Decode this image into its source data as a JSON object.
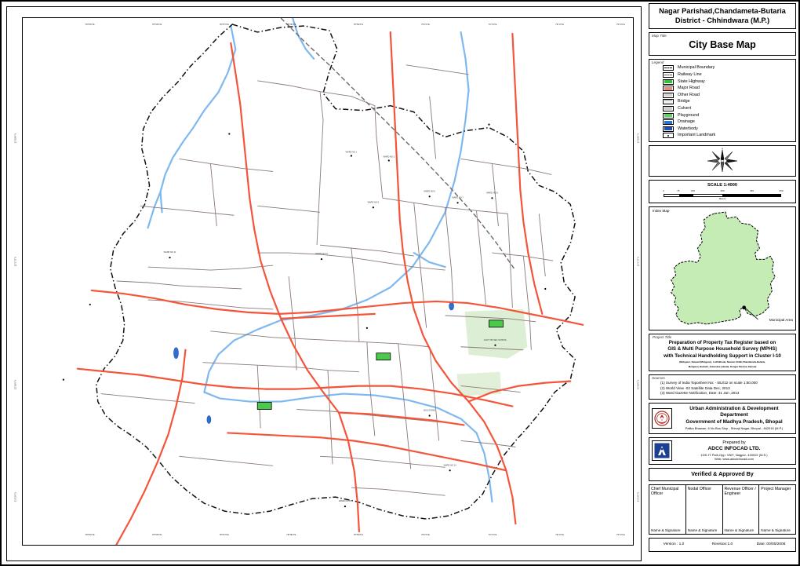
{
  "title_block": {
    "line1": "Nagar  Parishad,Chandameta-Butaria",
    "line2": "District - Chhindwara (M.P.)"
  },
  "map_title": {
    "label": "Map Title",
    "value": "City Base Map"
  },
  "legend": {
    "label": "Legend",
    "items": [
      {
        "name": "Municipal Boundary",
        "symbol": "dashed-boundary",
        "color": "#000000"
      },
      {
        "name": "Railway Line",
        "symbol": "railway-dash",
        "color": "#4a4a4a"
      },
      {
        "name": "State Highway",
        "symbol": "fill-block",
        "color": "#35c135"
      },
      {
        "name": "Major Road",
        "symbol": "fill-block",
        "color": "#f08878"
      },
      {
        "name": "Other Road",
        "symbol": "fill-block",
        "color": "#d9d4d4"
      },
      {
        "name": "Bridge",
        "symbol": "fill-block",
        "color": "#efefef"
      },
      {
        "name": "Culvert",
        "symbol": "fill-block",
        "color": "#cfcfcf"
      },
      {
        "name": "Playground",
        "symbol": "fill-block",
        "color": "#59d659"
      },
      {
        "name": "Drainage",
        "symbol": "fill-block",
        "color": "#2a72d4"
      },
      {
        "name": "Waterbody",
        "symbol": "fill-block",
        "color": "#1d4fb8"
      },
      {
        "name": "Important Landmark",
        "symbol": "point-dot",
        "color": "#000000"
      }
    ]
  },
  "north_arrow": {
    "label": "N"
  },
  "scale": {
    "title": "SCALE 1:4000",
    "ticks": [
      "0",
      "75",
      "150",
      "300",
      "450",
      "600"
    ],
    "unit": "Meters"
  },
  "index_map": {
    "label": "Index Map",
    "annotation": "Municipal Area",
    "fill_color": "#c4ecb4"
  },
  "project": {
    "label": "Project Title",
    "line1": "Preparation of Property Tax Register based on",
    "line2": "GIS & Multi Purpose Household Survey (MPHS)",
    "line3": "with Technical Handholding Support in Cluster I-10",
    "fine1": "(Mohgaon, Kelwad (Mohgaon), Lodhikheda, Newton-Chikli,Chandameta-Butaria,",
    "fine2": "Mohgaon, Barkuhi, Jamunbra (Jamai), Dongar Parasia, Damua)"
  },
  "sources": {
    "label": "Sources",
    "items": [
      "(1) Survey of India Toposheet No: - 55J/12 on scale 1:50,000",
      "(2) World View -02 Satellite Data Dec, 2013",
      "(3) Ward Gazette Notification, Date: 31 Jan ,2014"
    ]
  },
  "department": {
    "line1": "Urban Administration & Development Department",
    "line2": "Government of Madhya Pradesh, Bhopal",
    "address": "Palika Bhawan, 6 No Bus Stop , Shivaji Nagar, Bhopal - 462016 (M.P.)",
    "logo": "uadd-seal-icon"
  },
  "prepared_by": {
    "label": "Prepared by",
    "company": "ADCC INFOCAD LTD.",
    "address": "10/5 JT Park,Opp: VNIT, Nagpur- 440022 (M.S.)",
    "web": "Web: www.adccinfocad.com",
    "logo": "adcc-logo-icon"
  },
  "verification": {
    "header": "Verified & Approved By",
    "columns": [
      {
        "role": "Chief Municipal Officer",
        "sign": "Name & Signature"
      },
      {
        "role": "Nodal Officer",
        "sign": "Name & Signature"
      },
      {
        "role": "Revenue Officer / Engineer",
        "sign": "Name & Signature"
      },
      {
        "role": "Project Manager",
        "sign": "Name & Signature"
      }
    ]
  },
  "footer": {
    "version": "Version : 1.0",
    "revision": "Revision:1.0",
    "date": "Date: 00/00/2006"
  },
  "map_grid": {
    "top_ticks": [
      "78°55'0\"E",
      "78°56'0\"E",
      "78°57'0\"E",
      "78°58'0\"E",
      "78°59'0\"E",
      "79°0'0\"E",
      "79°1'0\"E",
      "79°2'0\"E",
      "79°3'0\"E"
    ],
    "bottom_ticks": [
      "78°55'0\"E",
      "78°56'0\"E",
      "78°57'0\"E",
      "78°58'0\"E",
      "78°59'0\"E",
      "79°0'0\"E",
      "79°1'0\"E",
      "79°2'0\"E",
      "79°3'0\"E"
    ],
    "left_ticks": [
      "22°18'0\"N",
      "22°17'0\"N",
      "22°16'0\"N",
      "22°15'0\"N"
    ],
    "right_ticks": [
      "22°18'0\"N",
      "22°17'0\"N",
      "22°16'0\"N",
      "22°15'0\"N"
    ]
  },
  "map_colors": {
    "major_road": "#f4553a",
    "other_road": "#8a7a78",
    "drainage": "#7fb8ef",
    "waterbody": "#2f6fd0",
    "boundary": "#111111",
    "railway": "#6b6b6b",
    "playground": "#4cc94c",
    "park_fill": "#d8ecd0"
  }
}
